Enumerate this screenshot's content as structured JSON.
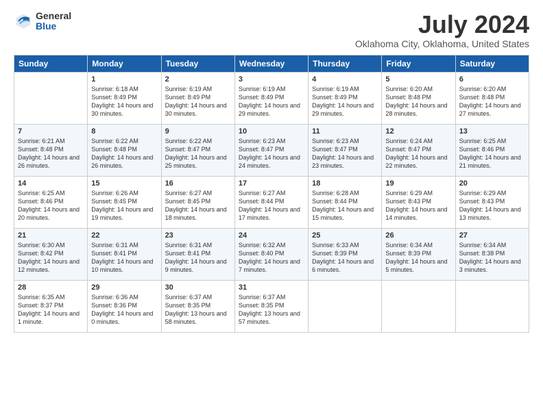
{
  "logo": {
    "general": "General",
    "blue": "Blue"
  },
  "title": "July 2024",
  "subtitle": "Oklahoma City, Oklahoma, United States",
  "weekdays": [
    "Sunday",
    "Monday",
    "Tuesday",
    "Wednesday",
    "Thursday",
    "Friday",
    "Saturday"
  ],
  "weeks": [
    [
      {
        "day": "",
        "sunrise": "",
        "sunset": "",
        "daylight": ""
      },
      {
        "day": "1",
        "sunrise": "Sunrise: 6:18 AM",
        "sunset": "Sunset: 8:49 PM",
        "daylight": "Daylight: 14 hours and 30 minutes."
      },
      {
        "day": "2",
        "sunrise": "Sunrise: 6:19 AM",
        "sunset": "Sunset: 8:49 PM",
        "daylight": "Daylight: 14 hours and 30 minutes."
      },
      {
        "day": "3",
        "sunrise": "Sunrise: 6:19 AM",
        "sunset": "Sunset: 8:49 PM",
        "daylight": "Daylight: 14 hours and 29 minutes."
      },
      {
        "day": "4",
        "sunrise": "Sunrise: 6:19 AM",
        "sunset": "Sunset: 8:49 PM",
        "daylight": "Daylight: 14 hours and 29 minutes."
      },
      {
        "day": "5",
        "sunrise": "Sunrise: 6:20 AM",
        "sunset": "Sunset: 8:48 PM",
        "daylight": "Daylight: 14 hours and 28 minutes."
      },
      {
        "day": "6",
        "sunrise": "Sunrise: 6:20 AM",
        "sunset": "Sunset: 8:48 PM",
        "daylight": "Daylight: 14 hours and 27 minutes."
      }
    ],
    [
      {
        "day": "7",
        "sunrise": "Sunrise: 6:21 AM",
        "sunset": "Sunset: 8:48 PM",
        "daylight": "Daylight: 14 hours and 26 minutes."
      },
      {
        "day": "8",
        "sunrise": "Sunrise: 6:22 AM",
        "sunset": "Sunset: 8:48 PM",
        "daylight": "Daylight: 14 hours and 26 minutes."
      },
      {
        "day": "9",
        "sunrise": "Sunrise: 6:22 AM",
        "sunset": "Sunset: 8:47 PM",
        "daylight": "Daylight: 14 hours and 25 minutes."
      },
      {
        "day": "10",
        "sunrise": "Sunrise: 6:23 AM",
        "sunset": "Sunset: 8:47 PM",
        "daylight": "Daylight: 14 hours and 24 minutes."
      },
      {
        "day": "11",
        "sunrise": "Sunrise: 6:23 AM",
        "sunset": "Sunset: 8:47 PM",
        "daylight": "Daylight: 14 hours and 23 minutes."
      },
      {
        "day": "12",
        "sunrise": "Sunrise: 6:24 AM",
        "sunset": "Sunset: 8:47 PM",
        "daylight": "Daylight: 14 hours and 22 minutes."
      },
      {
        "day": "13",
        "sunrise": "Sunrise: 6:25 AM",
        "sunset": "Sunset: 8:46 PM",
        "daylight": "Daylight: 14 hours and 21 minutes."
      }
    ],
    [
      {
        "day": "14",
        "sunrise": "Sunrise: 6:25 AM",
        "sunset": "Sunset: 8:46 PM",
        "daylight": "Daylight: 14 hours and 20 minutes."
      },
      {
        "day": "15",
        "sunrise": "Sunrise: 6:26 AM",
        "sunset": "Sunset: 8:45 PM",
        "daylight": "Daylight: 14 hours and 19 minutes."
      },
      {
        "day": "16",
        "sunrise": "Sunrise: 6:27 AM",
        "sunset": "Sunset: 8:45 PM",
        "daylight": "Daylight: 14 hours and 18 minutes."
      },
      {
        "day": "17",
        "sunrise": "Sunrise: 6:27 AM",
        "sunset": "Sunset: 8:44 PM",
        "daylight": "Daylight: 14 hours and 17 minutes."
      },
      {
        "day": "18",
        "sunrise": "Sunrise: 6:28 AM",
        "sunset": "Sunset: 8:44 PM",
        "daylight": "Daylight: 14 hours and 15 minutes."
      },
      {
        "day": "19",
        "sunrise": "Sunrise: 6:29 AM",
        "sunset": "Sunset: 8:43 PM",
        "daylight": "Daylight: 14 hours and 14 minutes."
      },
      {
        "day": "20",
        "sunrise": "Sunrise: 6:29 AM",
        "sunset": "Sunset: 8:43 PM",
        "daylight": "Daylight: 14 hours and 13 minutes."
      }
    ],
    [
      {
        "day": "21",
        "sunrise": "Sunrise: 6:30 AM",
        "sunset": "Sunset: 8:42 PM",
        "daylight": "Daylight: 14 hours and 12 minutes."
      },
      {
        "day": "22",
        "sunrise": "Sunrise: 6:31 AM",
        "sunset": "Sunset: 8:41 PM",
        "daylight": "Daylight: 14 hours and 10 minutes."
      },
      {
        "day": "23",
        "sunrise": "Sunrise: 6:31 AM",
        "sunset": "Sunset: 8:41 PM",
        "daylight": "Daylight: 14 hours and 9 minutes."
      },
      {
        "day": "24",
        "sunrise": "Sunrise: 6:32 AM",
        "sunset": "Sunset: 8:40 PM",
        "daylight": "Daylight: 14 hours and 7 minutes."
      },
      {
        "day": "25",
        "sunrise": "Sunrise: 6:33 AM",
        "sunset": "Sunset: 8:39 PM",
        "daylight": "Daylight: 14 hours and 6 minutes."
      },
      {
        "day": "26",
        "sunrise": "Sunrise: 6:34 AM",
        "sunset": "Sunset: 8:39 PM",
        "daylight": "Daylight: 14 hours and 5 minutes."
      },
      {
        "day": "27",
        "sunrise": "Sunrise: 6:34 AM",
        "sunset": "Sunset: 8:38 PM",
        "daylight": "Daylight: 14 hours and 3 minutes."
      }
    ],
    [
      {
        "day": "28",
        "sunrise": "Sunrise: 6:35 AM",
        "sunset": "Sunset: 8:37 PM",
        "daylight": "Daylight: 14 hours and 1 minute."
      },
      {
        "day": "29",
        "sunrise": "Sunrise: 6:36 AM",
        "sunset": "Sunset: 8:36 PM",
        "daylight": "Daylight: 14 hours and 0 minutes."
      },
      {
        "day": "30",
        "sunrise": "Sunrise: 6:37 AM",
        "sunset": "Sunset: 8:35 PM",
        "daylight": "Daylight: 13 hours and 58 minutes."
      },
      {
        "day": "31",
        "sunrise": "Sunrise: 6:37 AM",
        "sunset": "Sunset: 8:35 PM",
        "daylight": "Daylight: 13 hours and 57 minutes."
      },
      {
        "day": "",
        "sunrise": "",
        "sunset": "",
        "daylight": ""
      },
      {
        "day": "",
        "sunrise": "",
        "sunset": "",
        "daylight": ""
      },
      {
        "day": "",
        "sunrise": "",
        "sunset": "",
        "daylight": ""
      }
    ]
  ]
}
